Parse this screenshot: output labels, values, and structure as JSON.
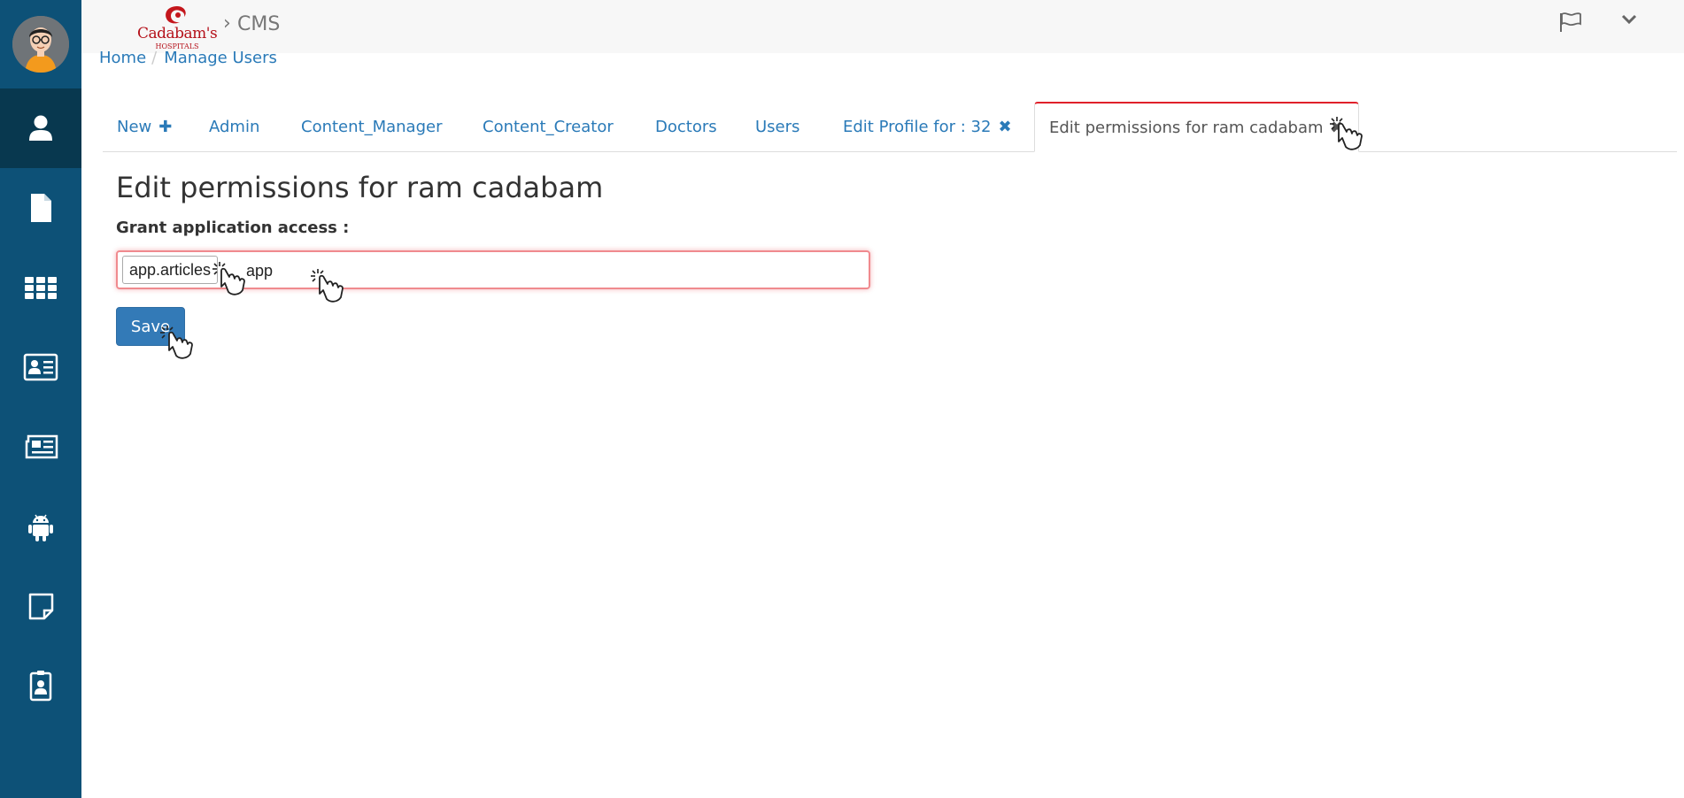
{
  "header": {
    "logo_text": "Cadabam's",
    "logo_subtext": "HOSPITALS",
    "breadcrumb_separator": "›",
    "app_name": "CMS",
    "icons": [
      "flag-icon",
      "chevron-down-icon"
    ]
  },
  "breadcrumb": {
    "items": [
      {
        "label": "Home"
      },
      {
        "label": "Manage Users"
      }
    ],
    "separator": "/"
  },
  "sidebar": {
    "items": [
      {
        "icon": "user-icon",
        "active": true
      },
      {
        "icon": "file-icon",
        "active": false
      },
      {
        "icon": "grid-icon",
        "active": false
      },
      {
        "icon": "id-card-icon",
        "active": false
      },
      {
        "icon": "newspaper-icon",
        "active": false
      },
      {
        "icon": "android-icon",
        "active": false
      },
      {
        "icon": "note-icon",
        "active": false
      },
      {
        "icon": "id-badge-icon",
        "active": false
      }
    ]
  },
  "tabs": [
    {
      "label": "New",
      "suffix": "✚"
    },
    {
      "label": "Admin"
    },
    {
      "label": "Content_Manager"
    },
    {
      "label": "Content_Creator"
    },
    {
      "label": "Doctors"
    },
    {
      "label": "Users"
    },
    {
      "label": "Edit Profile for : 32",
      "suffix": "✖"
    },
    {
      "label": "Edit permissions for ram cadabam",
      "suffix": "✖",
      "active": true
    }
  ],
  "main": {
    "title": "Edit permissions for ram cadabam",
    "access_label": "Grant application access :",
    "selected_tag": "app.articles",
    "typed_value": "app",
    "save_label": "Save"
  },
  "colors": {
    "sidebar_bg": "#0d5177",
    "sidebar_active": "#08384f",
    "link": "#2a7ab8",
    "primary_button": "#337ab7",
    "error_border": "#f08a8e",
    "brand_red": "#b5121b"
  }
}
